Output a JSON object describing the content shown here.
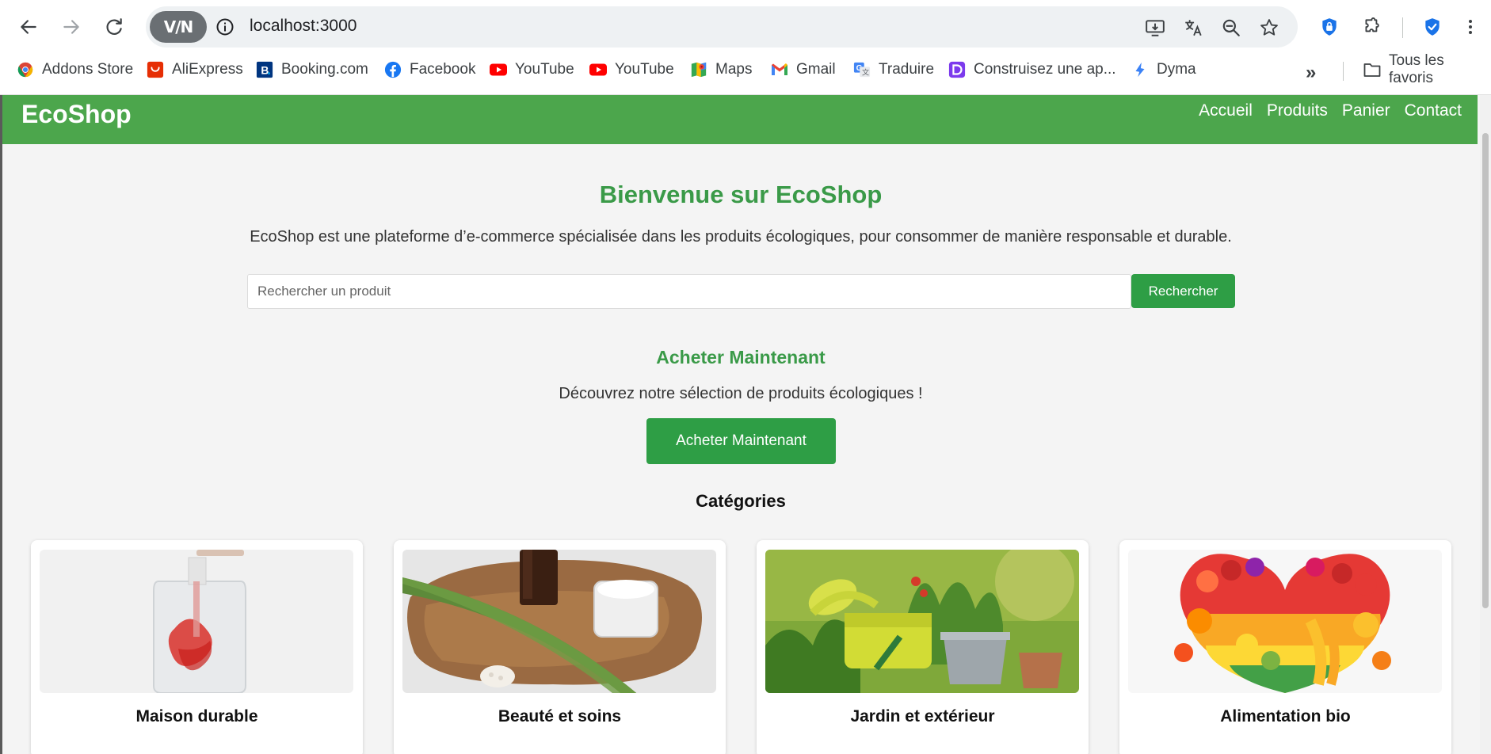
{
  "browser": {
    "vpn_label": "V/N",
    "url": "localhost:3000",
    "bookmarks": [
      {
        "label": "Addons Store",
        "icon": "addons-store-icon"
      },
      {
        "label": "AliExpress",
        "icon": "aliexpress-icon"
      },
      {
        "label": "Booking.com",
        "icon": "booking-icon"
      },
      {
        "label": "Facebook",
        "icon": "facebook-icon"
      },
      {
        "label": "YouTube",
        "icon": "youtube-icon"
      },
      {
        "label": "YouTube",
        "icon": "youtube-icon"
      },
      {
        "label": "Maps",
        "icon": "maps-icon"
      },
      {
        "label": "Gmail",
        "icon": "gmail-icon"
      },
      {
        "label": "Traduire",
        "icon": "translate-icon"
      },
      {
        "label": "Construisez une ap...",
        "icon": "app-builder-icon"
      },
      {
        "label": "Dyma",
        "icon": "dyma-icon"
      }
    ],
    "all_bookmarks_label": "Tous les favoris"
  },
  "site": {
    "logo": "EcoShop",
    "nav": [
      "Accueil",
      "Produits",
      "Panier",
      "Contact"
    ],
    "hero": {
      "title": "Bienvenue sur EcoShop",
      "text": "EcoShop est une plateforme d’e-commerce spécialisée dans les produits écologiques, pour consommer de manière responsable et durable."
    },
    "search": {
      "placeholder": "Rechercher un produit",
      "value": "",
      "button": "Rechercher"
    },
    "cta": {
      "title": "Acheter Maintenant",
      "text": "Découvrez notre sélection de produits écologiques !",
      "button": "Acheter Maintenant"
    },
    "categories": {
      "title": "Catégories",
      "items": [
        {
          "label": "Maison durable"
        },
        {
          "label": "Beauté et soins"
        },
        {
          "label": "Jardin et extérieur"
        },
        {
          "label": "Alimentation bio"
        }
      ]
    }
  },
  "colors": {
    "header_green": "#4ca64c",
    "button_green": "#2e9e45",
    "title_green": "#3a9a48",
    "page_background": "#f4f4f4"
  }
}
